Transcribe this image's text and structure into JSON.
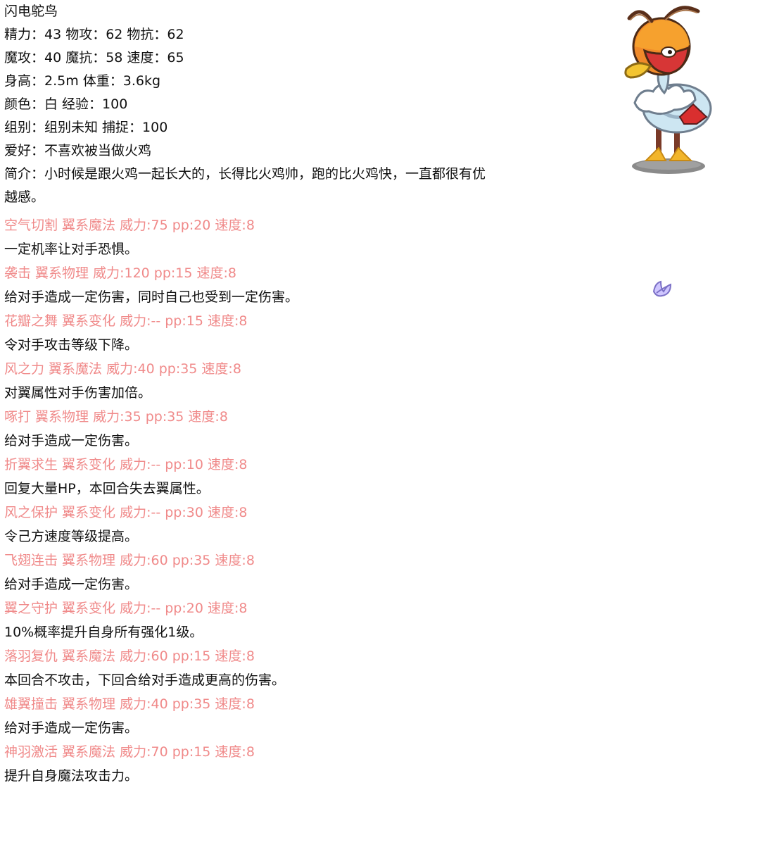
{
  "name": "闪电鸵鸟",
  "stats": {
    "line1": "精力：43 物攻：62 物抗：62",
    "line2": "魔攻：40 魔抗：58 速度：65",
    "line3": "身高：2.5m 体重：3.6kg",
    "line4": "颜色：白 经验：100",
    "line5": "组别：组别未知 捕捉：100",
    "line6": "爱好：不喜欢被当做火鸡"
  },
  "intro": "简介：小时候是跟火鸡一起长大的，长得比火鸡帅，跑的比火鸡快，一直都很有优越感。",
  "skills": [
    {
      "title": "空气切割 翼系魔法 威力:75 pp:20 速度:8",
      "desc": "一定机率让对手恐惧。"
    },
    {
      "title": "袭击 翼系物理 威力:120 pp:15 速度:8",
      "desc": "给对手造成一定伤害，同时自己也受到一定伤害。"
    },
    {
      "title": "花瓣之舞 翼系变化 威力:-- pp:15 速度:8",
      "desc": "令对手攻击等级下降。"
    },
    {
      "title": "风之力 翼系魔法 威力:40 pp:35 速度:8",
      "desc": "对翼属性对手伤害加倍。"
    },
    {
      "title": "啄打 翼系物理 威力:35 pp:35 速度:8",
      "desc": "给对手造成一定伤害。"
    },
    {
      "title": "折翼求生 翼系变化 威力:-- pp:10 速度:8",
      "desc": "回复大量HP，本回合失去翼属性。"
    },
    {
      "title": "风之保护 翼系变化 威力:-- pp:30 速度:8",
      "desc": "令己方速度等级提高。"
    },
    {
      "title": "飞翅连击 翼系物理 威力:60 pp:35 速度:8",
      "desc": "给对手造成一定伤害。"
    },
    {
      "title": "翼之守护 翼系变化 威力:-- pp:20 速度:8",
      "desc": "10%概率提升自身所有强化1级。"
    },
    {
      "title": "落羽复仇 翼系魔法 威力:60 pp:15 速度:8",
      "desc": "本回合不攻击，下回合给对手造成更高的伤害。"
    },
    {
      "title": "雄翼撞击 翼系物理 威力:40 pp:35 速度:8",
      "desc": "给对手造成一定伤害。"
    },
    {
      "title": "神羽激活 翼系魔法 威力:70 pp:15 速度:8",
      "desc": "提升自身魔法攻击力。"
    }
  ],
  "colors": {
    "skill_title": "#f08a8a",
    "text": "#111111"
  },
  "icons": {
    "creature": "ostrich-creature-image",
    "feather": "feather-icon"
  }
}
